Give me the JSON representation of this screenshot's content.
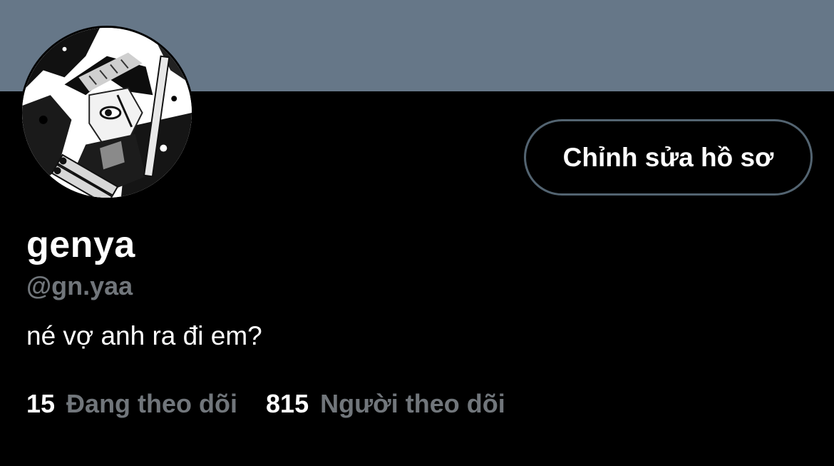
{
  "colors": {
    "banner": "#667788",
    "background": "#000000",
    "secondary_text": "#71767b",
    "button_border": "#536471"
  },
  "profile": {
    "display_name": "genya",
    "handle": "@gn.yaa",
    "bio": "né vợ anh ra đi em?",
    "avatar_description": "manga-style-avatar"
  },
  "actions": {
    "edit_profile_label": "Chỉnh sửa hồ sơ"
  },
  "stats": {
    "following_count": "15",
    "following_label": "Đang theo dõi",
    "followers_count": "815",
    "followers_label": "Người theo dõi"
  }
}
